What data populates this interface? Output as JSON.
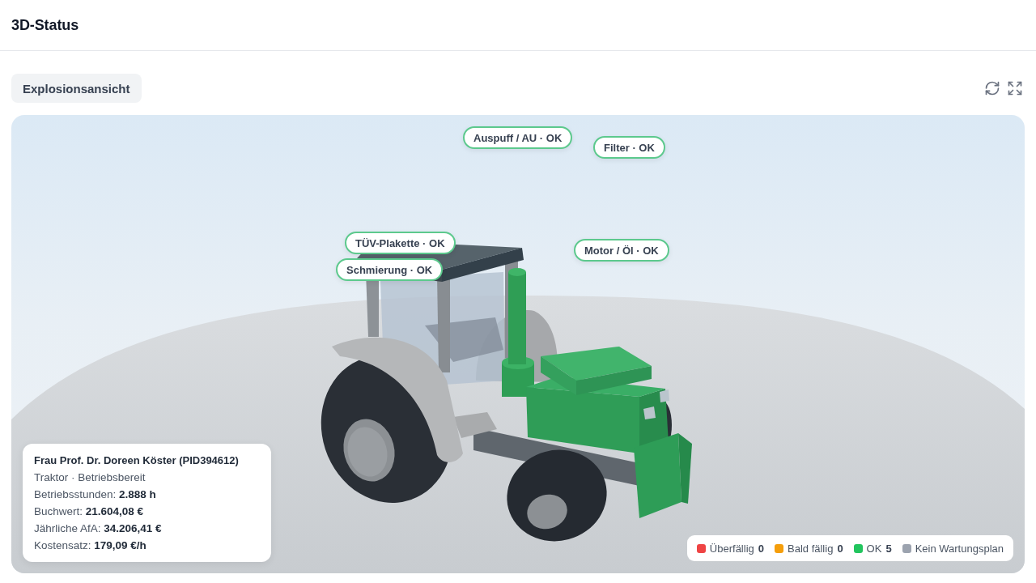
{
  "header": {
    "title": "3D-Status"
  },
  "toolbar": {
    "view_button": "Explosionsansicht"
  },
  "markers": [
    {
      "label": "Auspuff / AU · OK",
      "color": "#5cc98d"
    },
    {
      "label": "Filter · OK",
      "color": "#5cc98d"
    },
    {
      "label": "TÜV-Plakette · OK",
      "color": "#5cc98d"
    },
    {
      "label": "Schmierung · OK",
      "color": "#5cc98d"
    },
    {
      "label": "Motor / Öl · OK",
      "color": "#5cc98d"
    }
  ],
  "info_card": {
    "title": "Frau Prof. Dr. Doreen Köster (PID394612)",
    "subtitle": "Traktor · Betriebsbereit",
    "lines": [
      "Betriebsstunden: **2.888 h**",
      "Buchwert: **21.604,08 €**",
      "Jährliche AfA: **34.206,41 €**",
      "Kostensatz: **179,09 €/h**"
    ]
  },
  "legend": [
    {
      "label": "Überfällig",
      "count": "0",
      "color": "#ef4444"
    },
    {
      "label": "Bald fällig",
      "count": "0",
      "color": "#f59e0b"
    },
    {
      "label": "OK",
      "count": "5",
      "color": "#22c55e"
    },
    {
      "label": "Kein Wartungsplan",
      "color": "#9ca3af"
    }
  ]
}
